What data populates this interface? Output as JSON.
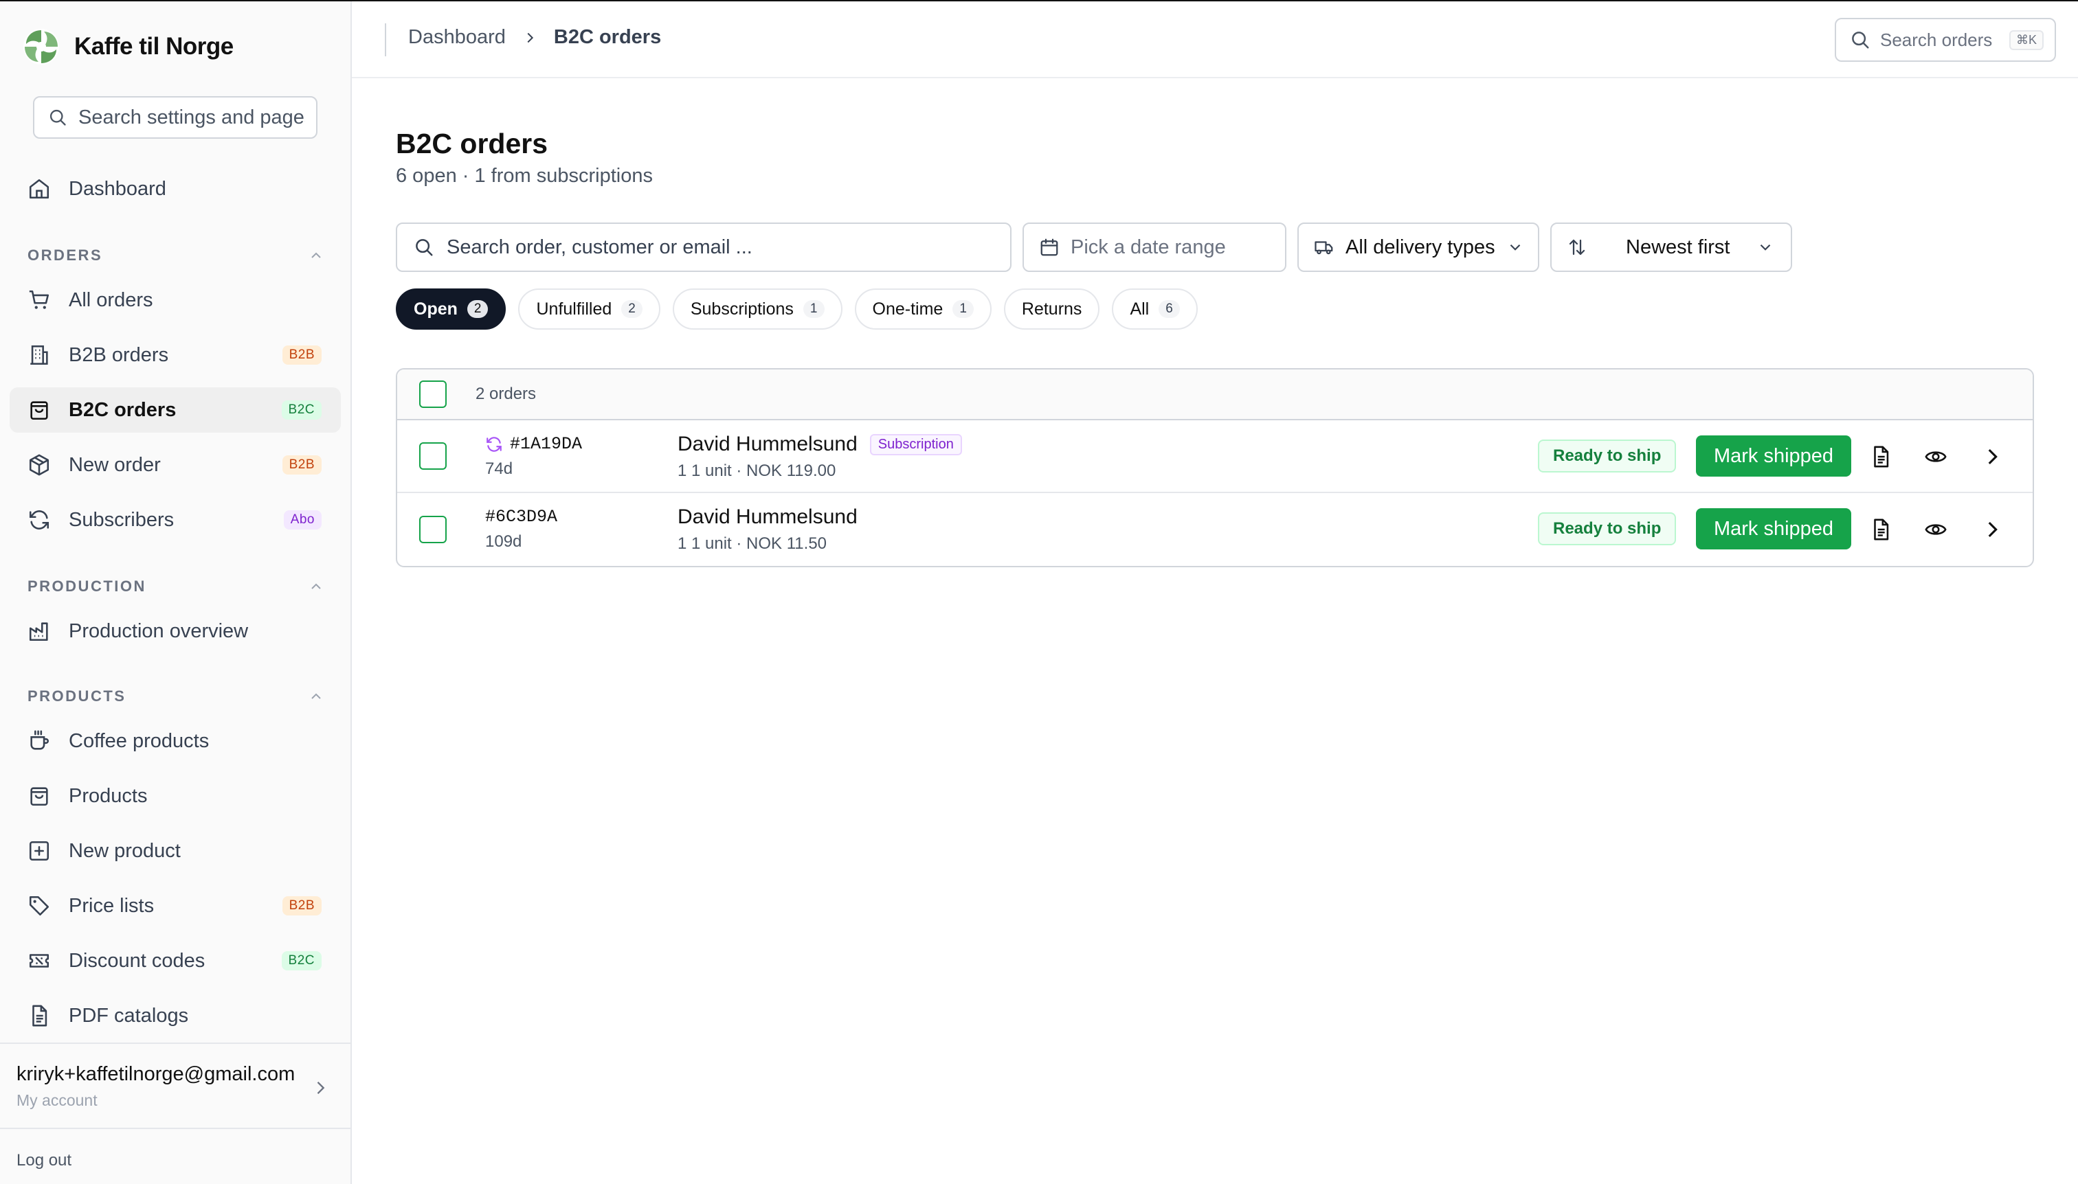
{
  "brand": {
    "name": "Kaffe til Norge"
  },
  "sidebar": {
    "search_placeholder": "Search settings and pages",
    "dashboard": "Dashboard",
    "sections": {
      "orders": "ORDERS",
      "production": "PRODUCTION",
      "products": "PRODUCTS"
    },
    "items": [
      {
        "label": "All orders"
      },
      {
        "label": "B2B orders",
        "badge": "B2B"
      },
      {
        "label": "B2C orders",
        "badge": "B2C",
        "active": true
      },
      {
        "label": "New order",
        "badge": "B2B"
      },
      {
        "label": "Subscribers",
        "badge": "Abo"
      },
      {
        "label": "Production overview"
      },
      {
        "label": "Coffee products"
      },
      {
        "label": "Products"
      },
      {
        "label": "New product"
      },
      {
        "label": "Price lists",
        "badge": "B2B"
      },
      {
        "label": "Discount codes",
        "badge": "B2C"
      },
      {
        "label": "PDF catalogs"
      }
    ],
    "account": {
      "email": "kriryk+kaffetilnorge@gmail.com",
      "subtitle": "My account"
    },
    "logout": "Log out"
  },
  "topbar": {
    "breadcrumb": [
      "Dashboard",
      "B2C orders"
    ],
    "search_label": "Search orders",
    "shortcut": "⌘K"
  },
  "page": {
    "title": "B2C orders",
    "subtitle": "6 open · 1 from subscriptions"
  },
  "filters": {
    "search_placeholder": "Search order, customer or email ...",
    "date_placeholder": "Pick a date range",
    "delivery": "All delivery types",
    "sort": "Newest first"
  },
  "tabs": [
    {
      "label": "Open",
      "count": "2",
      "active": true
    },
    {
      "label": "Unfulfilled",
      "count": "2"
    },
    {
      "label": "Subscriptions",
      "count": "1"
    },
    {
      "label": "One-time",
      "count": "1"
    },
    {
      "label": "Returns"
    },
    {
      "label": "All",
      "count": "6"
    }
  ],
  "table": {
    "count_label": "2 orders",
    "rows": [
      {
        "id": "#1A19DA",
        "age": "74d",
        "customer": "David Hummelsund",
        "tag": "Subscription",
        "meta": "1 1 unit · NOK 119.00",
        "status": "Ready to ship",
        "action": "Mark shipped",
        "recurring": true
      },
      {
        "id": "#6C3D9A",
        "age": "109d",
        "customer": "David Hummelsund",
        "meta": "1 1 unit · NOK 11.50",
        "status": "Ready to ship",
        "action": "Mark shipped"
      }
    ]
  },
  "colors": {
    "accent_green": "#16a34a",
    "active_tab": "#111827",
    "b2b_badge": "#c2410c",
    "b2c_badge": "#15803d",
    "abo_badge": "#7e22ce"
  }
}
